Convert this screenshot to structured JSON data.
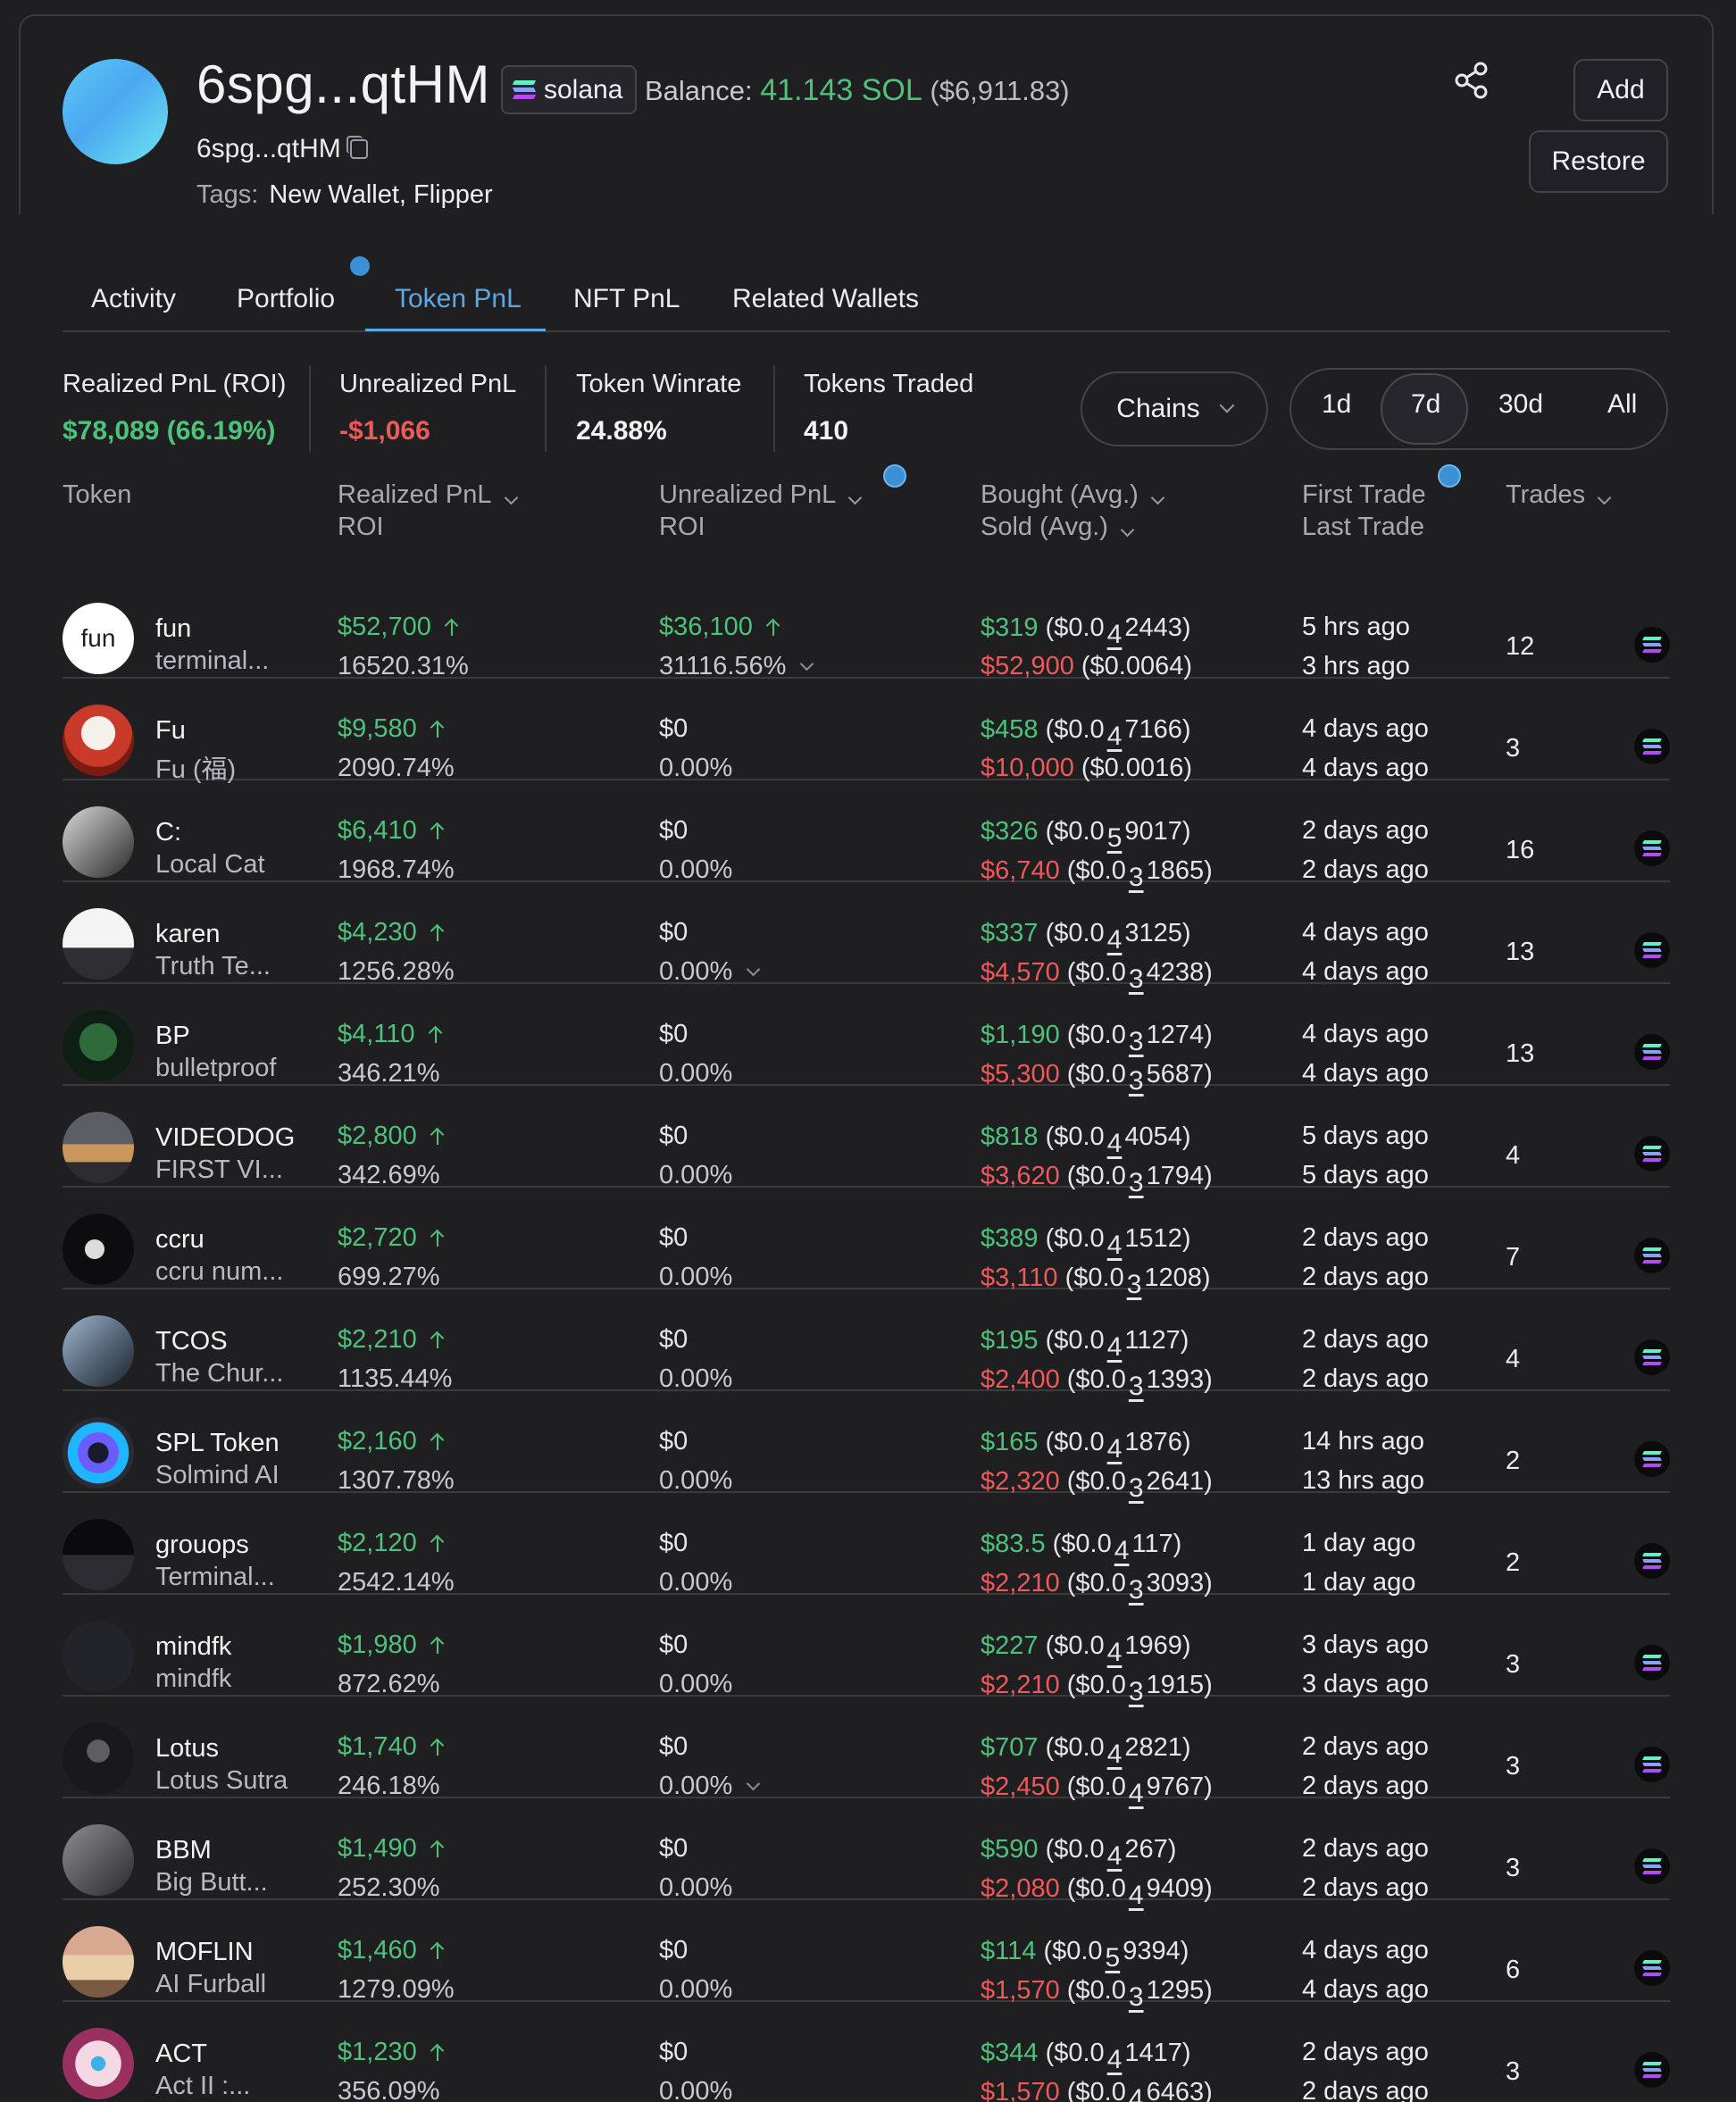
{
  "wallet": {
    "title": "6spg...qtHM",
    "chain": "solana",
    "balance_label": "Balance:",
    "balance_sol": "41.143 SOL",
    "balance_usd": "($6,911.83)",
    "address_short": "6spg...qtHM",
    "tags_label": "Tags:",
    "tags": "New Wallet, Flipper"
  },
  "actions": {
    "add": "Add",
    "restore": "Restore"
  },
  "tabs": [
    {
      "label": "Activity"
    },
    {
      "label": "Portfolio"
    },
    {
      "label": "Token PnL",
      "active": true
    },
    {
      "label": "NFT PnL"
    },
    {
      "label": "Related Wallets"
    }
  ],
  "stats": {
    "realized_label": "Realized PnL (ROI)",
    "realized_value": "$78,089 (66.19%)",
    "unrealized_label": "Unrealized PnL",
    "unrealized_value": "-$1,066",
    "winrate_label": "Token Winrate",
    "winrate_value": "24.88%",
    "traded_label": "Tokens Traded",
    "traded_value": "410"
  },
  "filters": {
    "chains": "Chains",
    "periods": [
      "1d",
      "7d",
      "30d",
      "All"
    ],
    "active_period": "7d"
  },
  "columns": {
    "token": "Token",
    "realized_1": "Realized PnL",
    "realized_2": "ROI",
    "unrealized_1": "Unrealized PnL",
    "unrealized_2": "ROI",
    "bought": "Bought (Avg.)",
    "sold": "Sold (Avg.)",
    "first": "First Trade",
    "last": "Last Trade",
    "trades": "Trades"
  },
  "rows": [
    {
      "icon": "fun",
      "name": "fun",
      "full": "terminal...",
      "rpnl": "$52,700",
      "rroi": "16520.31%",
      "upnl": "$36,100",
      "upnl_up": true,
      "uroi": "31116.56%",
      "uroi_chev": true,
      "bought": "$319",
      "b_pre": "($0.0",
      "b_sub": "4",
      "b_post": "2443)",
      "sold": "$52,900",
      "s_pre": "($0.0064)",
      "s_sub": "",
      "s_post": "",
      "first": "5 hrs ago",
      "last": "3 hrs ago",
      "trades": "12"
    },
    {
      "icon": "",
      "name": "Fu",
      "full": "Fu (福)",
      "rpnl": "$9,580",
      "rroi": "2090.74%",
      "upnl": "$0",
      "uroi": "0.00%",
      "bought": "$458",
      "b_pre": "($0.0",
      "b_sub": "4",
      "b_post": "7166)",
      "sold": "$10,000",
      "s_pre": "($0.0016)",
      "s_sub": "",
      "s_post": "",
      "first": "4 days ago",
      "last": "4 days ago",
      "trades": "3"
    },
    {
      "icon": "",
      "name": "C:",
      "full": "Local Cat",
      "rpnl": "$6,410",
      "rroi": "1968.74%",
      "upnl": "$0",
      "uroi": "0.00%",
      "bought": "$326",
      "b_pre": "($0.0",
      "b_sub": "5",
      "b_post": "9017)",
      "sold": "$6,740",
      "s_pre": "($0.0",
      "s_sub": "3",
      "s_post": "1865)",
      "first": "2 days ago",
      "last": "2 days ago",
      "trades": "16"
    },
    {
      "icon": "",
      "name": "karen",
      "full": "Truth Te...",
      "rpnl": "$4,230",
      "rroi": "1256.28%",
      "upnl": "$0",
      "uroi": "0.00%",
      "uroi_chev": true,
      "bought": "$337",
      "b_pre": "($0.0",
      "b_sub": "4",
      "b_post": "3125)",
      "sold": "$4,570",
      "s_pre": "($0.0",
      "s_sub": "3",
      "s_post": "4238)",
      "first": "4 days ago",
      "last": "4 days ago",
      "trades": "13"
    },
    {
      "icon": "",
      "name": "BP",
      "full": "bulletproof",
      "rpnl": "$4,110",
      "rroi": "346.21%",
      "upnl": "$0",
      "uroi": "0.00%",
      "bought": "$1,190",
      "b_pre": "($0.0",
      "b_sub": "3",
      "b_post": "1274)",
      "sold": "$5,300",
      "s_pre": "($0.0",
      "s_sub": "3",
      "s_post": "5687)",
      "first": "4 days ago",
      "last": "4 days ago",
      "trades": "13"
    },
    {
      "icon": "",
      "name": "VIDEODOG",
      "full": "FIRST VI...",
      "rpnl": "$2,800",
      "rroi": "342.69%",
      "upnl": "$0",
      "uroi": "0.00%",
      "bought": "$818",
      "b_pre": "($0.0",
      "b_sub": "4",
      "b_post": "4054)",
      "sold": "$3,620",
      "s_pre": "($0.0",
      "s_sub": "3",
      "s_post": "1794)",
      "first": "5 days ago",
      "last": "5 days ago",
      "trades": "4"
    },
    {
      "icon": "",
      "name": "ccru",
      "full": "ccru num...",
      "rpnl": "$2,720",
      "rroi": "699.27%",
      "upnl": "$0",
      "uroi": "0.00%",
      "bought": "$389",
      "b_pre": "($0.0",
      "b_sub": "4",
      "b_post": "1512)",
      "sold": "$3,110",
      "s_pre": "($0.0",
      "s_sub": "3",
      "s_post": "1208)",
      "first": "2 days ago",
      "last": "2 days ago",
      "trades": "7"
    },
    {
      "icon": "",
      "name": "TCOS",
      "full": "The Chur...",
      "rpnl": "$2,210",
      "rroi": "1135.44%",
      "upnl": "$0",
      "uroi": "0.00%",
      "bought": "$195",
      "b_pre": "($0.0",
      "b_sub": "4",
      "b_post": "1127)",
      "sold": "$2,400",
      "s_pre": "($0.0",
      "s_sub": "3",
      "s_post": "1393)",
      "first": "2 days ago",
      "last": "2 days ago",
      "trades": "4"
    },
    {
      "icon": "",
      "name": "SPL Token",
      "full": "Solmind AI",
      "rpnl": "$2,160",
      "rroi": "1307.78%",
      "upnl": "$0",
      "uroi": "0.00%",
      "bought": "$165",
      "b_pre": "($0.0",
      "b_sub": "4",
      "b_post": "1876)",
      "sold": "$2,320",
      "s_pre": "($0.0",
      "s_sub": "3",
      "s_post": "2641)",
      "first": "14 hrs ago",
      "last": "13 hrs ago",
      "trades": "2"
    },
    {
      "icon": "",
      "name": "grouops",
      "full": "Terminal...",
      "rpnl": "$2,120",
      "rroi": "2542.14%",
      "upnl": "$0",
      "uroi": "0.00%",
      "bought": "$83.5",
      "b_pre": "($0.0",
      "b_sub": "4",
      "b_post": "117)",
      "sold": "$2,210",
      "s_pre": "($0.0",
      "s_sub": "3",
      "s_post": "3093)",
      "first": "1 day ago",
      "last": "1 day ago",
      "trades": "2"
    },
    {
      "icon": "",
      "name": "mindfk",
      "full": "mindfk",
      "rpnl": "$1,980",
      "rroi": "872.62%",
      "upnl": "$0",
      "uroi": "0.00%",
      "bought": "$227",
      "b_pre": "($0.0",
      "b_sub": "4",
      "b_post": "1969)",
      "sold": "$2,210",
      "s_pre": "($0.0",
      "s_sub": "3",
      "s_post": "1915)",
      "first": "3 days ago",
      "last": "3 days ago",
      "trades": "3"
    },
    {
      "icon": "",
      "name": "Lotus",
      "full": "Lotus Sutra",
      "rpnl": "$1,740",
      "rroi": "246.18%",
      "upnl": "$0",
      "uroi": "0.00%",
      "uroi_chev": true,
      "bought": "$707",
      "b_pre": "($0.0",
      "b_sub": "4",
      "b_post": "2821)",
      "sold": "$2,450",
      "s_pre": "($0.0",
      "s_sub": "4",
      "s_post": "9767)",
      "first": "2 days ago",
      "last": "2 days ago",
      "trades": "3"
    },
    {
      "icon": "",
      "name": "BBM",
      "full": "Big Butt...",
      "rpnl": "$1,490",
      "rroi": "252.30%",
      "upnl": "$0",
      "uroi": "0.00%",
      "bought": "$590",
      "b_pre": "($0.0",
      "b_sub": "4",
      "b_post": "267)",
      "sold": "$2,080",
      "s_pre": "($0.0",
      "s_sub": "4",
      "s_post": "9409)",
      "first": "2 days ago",
      "last": "2 days ago",
      "trades": "3"
    },
    {
      "icon": "",
      "name": "MOFLIN",
      "full": "AI Furball",
      "rpnl": "$1,460",
      "rroi": "1279.09%",
      "upnl": "$0",
      "uroi": "0.00%",
      "bought": "$114",
      "b_pre": "($0.0",
      "b_sub": "5",
      "b_post": "9394)",
      "sold": "$1,570",
      "s_pre": "($0.0",
      "s_sub": "3",
      "s_post": "1295)",
      "first": "4 days ago",
      "last": "4 days ago",
      "trades": "6"
    },
    {
      "icon": "",
      "name": "ACT",
      "full": "Act II :...",
      "rpnl": "$1,230",
      "rroi": "356.09%",
      "upnl": "$0",
      "uroi": "0.00%",
      "bought": "$344",
      "b_pre": "($0.0",
      "b_sub": "4",
      "b_post": "1417)",
      "sold": "$1,570",
      "s_pre": "($0.0",
      "s_sub": "4",
      "s_post": "6463)",
      "first": "2 days ago",
      "last": "2 days ago",
      "trades": "3"
    }
  ],
  "colors": {
    "green": "#4ec27a",
    "red": "#ec5a5a",
    "accent": "#5aa8e6",
    "bg": "#1f1f22"
  }
}
